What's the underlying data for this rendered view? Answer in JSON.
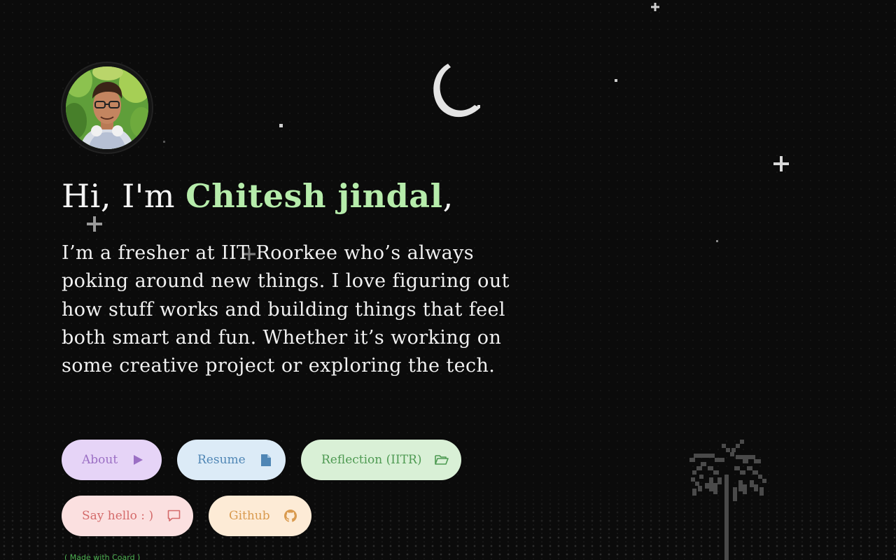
{
  "hero": {
    "greeting_prefix": "Hi, I'm ",
    "name": "Chitesh jindal",
    "greeting_suffix": ",",
    "bio": "I’m a fresher at IIT Roorkee who’s always poking around new things. I love figuring out how stuff works and building things that feel both smart and fun. Whether it’s working on some creative project or exploring the tech."
  },
  "buttons": {
    "about": {
      "label": "About",
      "icon": "play-icon",
      "bg": "#e6d4f7",
      "fg": "#9b6fc4"
    },
    "resume": {
      "label": "Resume",
      "icon": "document-icon",
      "bg": "#dcebf7",
      "fg": "#4f86b5"
    },
    "reflection": {
      "label": "Reflection (IITR)",
      "icon": "folder-open-icon",
      "bg": "#d9f0d6",
      "fg": "#4e9a52"
    },
    "say_hello": {
      "label": "Say hello : )",
      "icon": "chat-icon",
      "bg": "#fbe0e0",
      "fg": "#d46a6a"
    },
    "github": {
      "label": "Github",
      "icon": "github-icon",
      "bg": "#fdebd6",
      "fg": "#d99a4e"
    }
  },
  "footer": {
    "text": "( Made with Coard )"
  },
  "colors": {
    "background": "#0b0b0b",
    "accent_name": "#b6ecab",
    "text": "#f2f2f2"
  }
}
